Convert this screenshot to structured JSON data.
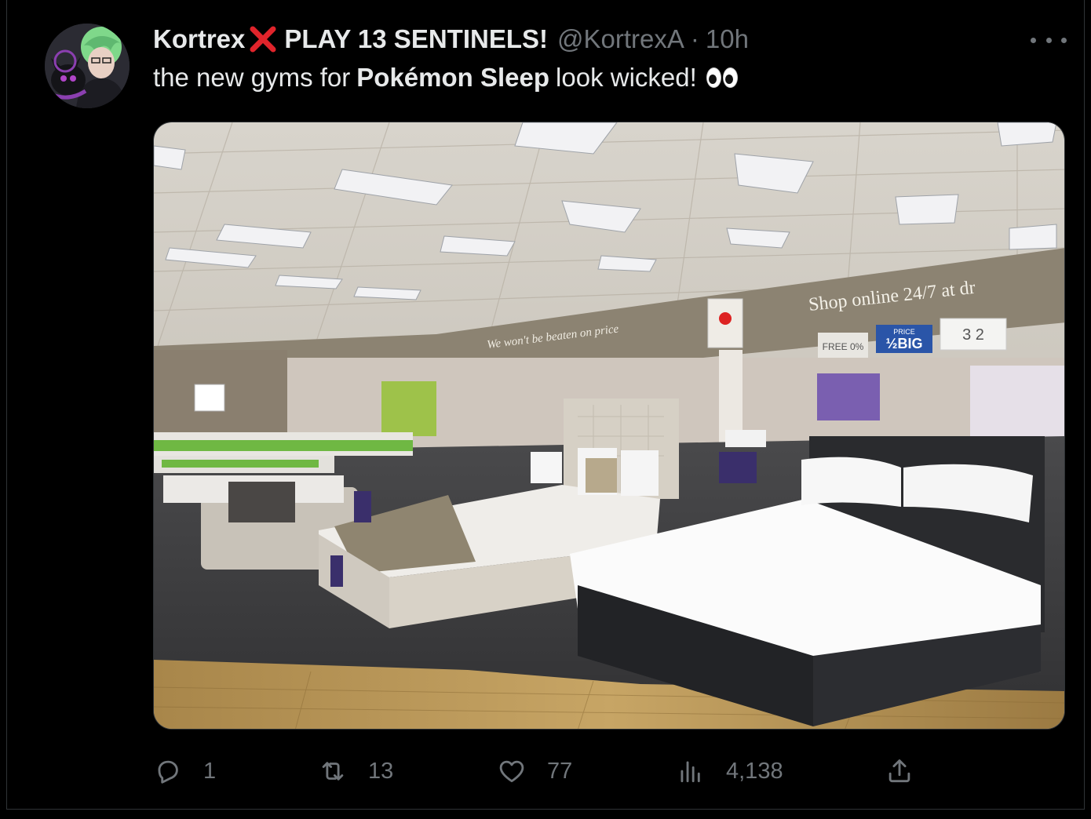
{
  "tweet": {
    "author": {
      "display_name": "Kortrex",
      "name_suffix": "PLAY 13 SENTINELS!",
      "handle": "@KortrexA",
      "separator": "·",
      "time": "10h",
      "emoji_name": "cross-mark-icon"
    },
    "text": {
      "before": "the new gyms for",
      "bold": "Pokémon Sleep",
      "after": "look wicked!",
      "emoji_name": "eyes-icon"
    },
    "media": {
      "banner_text": "Shop online 24/7 at dr",
      "slogan_text": "We won't be beaten on price",
      "sign_half_price": "½BIG",
      "sign_half_price_small": "PRICE",
      "sign_free": "FREE 0%",
      "sign_number": "3 2"
    },
    "actions": {
      "replies": "1",
      "retweets": "13",
      "likes": "77",
      "views": "4,138"
    }
  }
}
